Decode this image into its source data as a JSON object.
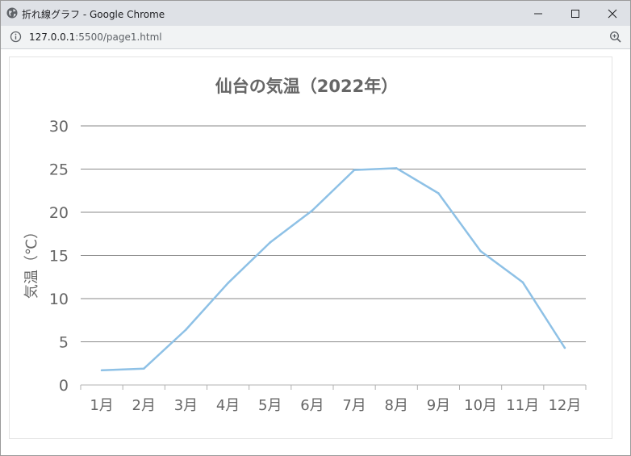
{
  "window": {
    "title": "折れ線グラフ - Google Chrome"
  },
  "address_bar": {
    "url_host": "127.0.0.1",
    "url_path": ":5500/page1.html"
  },
  "chart_data": {
    "type": "line",
    "title": "仙台の気温（2022年）",
    "ylabel": "気温（℃）",
    "xlabel": "",
    "categories": [
      "1月",
      "2月",
      "3月",
      "4月",
      "5月",
      "6月",
      "7月",
      "8月",
      "9月",
      "10月",
      "11月",
      "12月"
    ],
    "series": [
      {
        "values": [
          1.7,
          1.9,
          6.4,
          11.8,
          16.5,
          20.2,
          24.9,
          25.1,
          22.2,
          15.5,
          11.9,
          4.3
        ],
        "color": "#8ec1e6"
      }
    ],
    "ylim": [
      0,
      30
    ],
    "yticks": [
      0,
      5,
      10,
      15,
      20,
      25,
      30
    ],
    "grid": true,
    "legend": "none"
  }
}
